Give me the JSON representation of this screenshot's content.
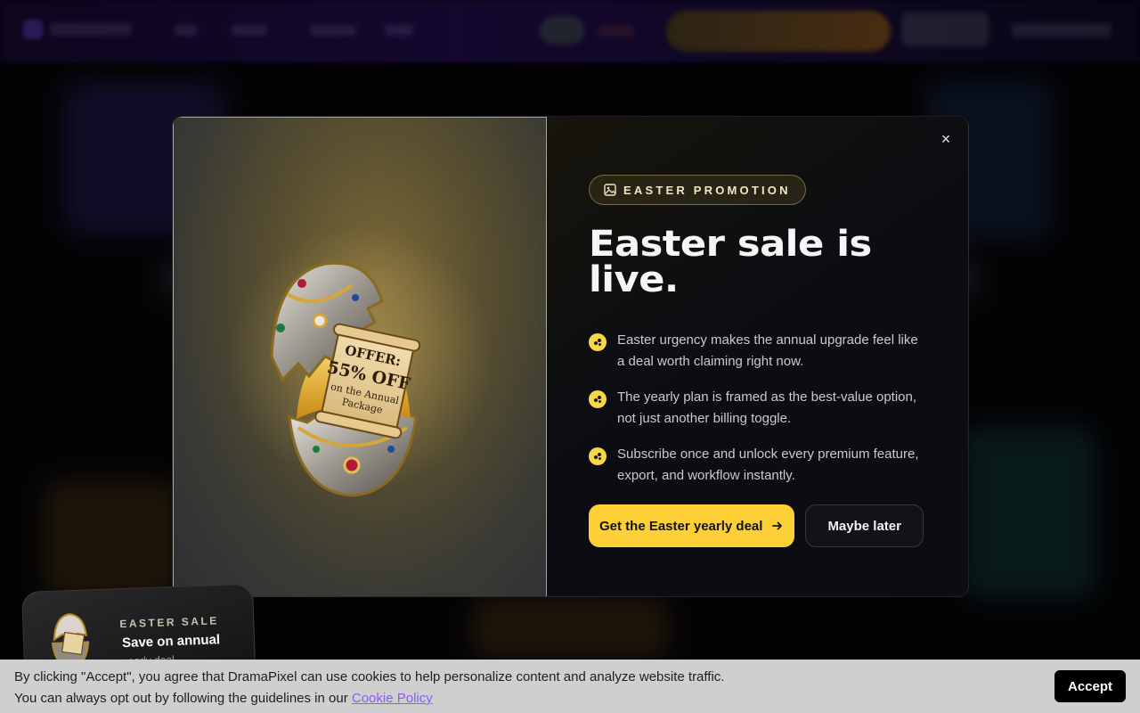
{
  "modal": {
    "badge": "EASTER PROMOTION",
    "title": "Easter sale is live.",
    "features": [
      "Easter urgency makes the annual upgrade feel like a deal worth claiming right now.",
      "The yearly plan is framed as the best-value option, not just another billing toggle.",
      "Subscribe once and unlock every premium feature, export, and workflow instantly."
    ],
    "primary_cta": "Get the Easter yearly deal",
    "secondary_cta": "Maybe later",
    "close_label": "×",
    "scroll_line1": "OFFER:",
    "scroll_line2": "55% OFF",
    "scroll_line3": "on the Annual",
    "scroll_line4": "Package"
  },
  "sale_card": {
    "kicker": "EASTER SALE",
    "title": "Save on annual",
    "subtitle": "yearly deal"
  },
  "cookie": {
    "line1": "By clicking \"Accept\", you agree that DramaPixel can use cookies to help personalize content and analyze website traffic.",
    "line2_prefix": "You can always opt out by following the guidelines in our ",
    "link": "Cookie Policy",
    "accept": "Accept"
  },
  "colors": {
    "accent": "#fcd036",
    "badge_text": "#f1e6c0",
    "cookie_link": "#8b5cf6"
  }
}
